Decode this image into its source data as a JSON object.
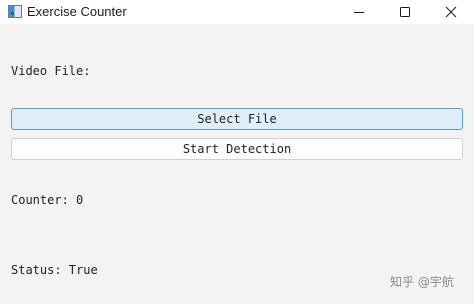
{
  "window": {
    "title": "Exercise Counter",
    "icons": {
      "app": "app-icon",
      "minimize": "minimize-icon",
      "maximize": "maximize-icon",
      "close": "close-icon"
    }
  },
  "main": {
    "video_file_label": "Video File:",
    "select_file_label": "Select File",
    "start_detection_label": "Start Detection",
    "counter_text": "Counter: 0",
    "status_text": "Status: True"
  },
  "watermark": "知乎 @宇航",
  "colors": {
    "background": "#f3f3f3",
    "focused_button_bg": "#e0eef9",
    "focused_button_border": "#5a9bd4"
  }
}
